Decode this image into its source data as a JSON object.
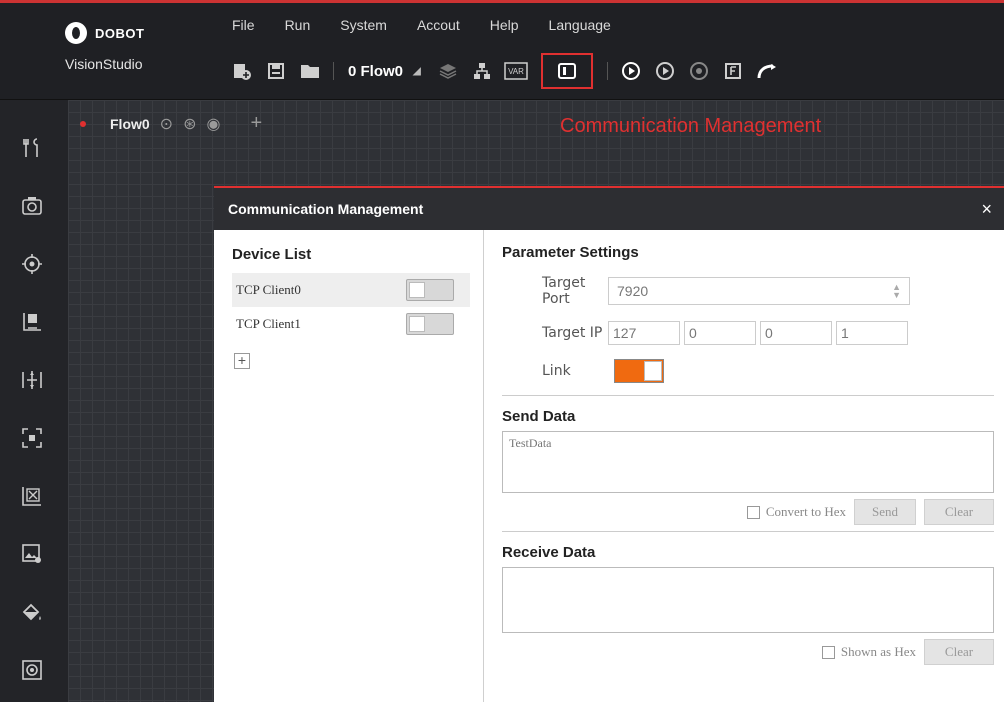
{
  "brand": {
    "name": "DOBOT",
    "product": "VisionStudio"
  },
  "menu": [
    "File",
    "Run",
    "System",
    "Accout",
    "Help",
    "Language"
  ],
  "toolbar": {
    "flow_selector": "0 Flow0",
    "var_label": "VAR"
  },
  "flow_tab": {
    "label": "Flow0"
  },
  "annotation": "Communication Management",
  "dialog": {
    "title": "Communication Management",
    "close": "×",
    "device_list": {
      "title": "Device List",
      "items": [
        {
          "label": "TCP Client0"
        },
        {
          "label": "TCP Client1"
        }
      ],
      "add": "+"
    },
    "params": {
      "title": "Parameter Settings",
      "target_port_label": "Target Port",
      "target_port_value": "7920",
      "target_ip_label": "Target IP",
      "ip": [
        "127",
        "0",
        "0",
        "1"
      ],
      "link_label": "Link"
    },
    "send": {
      "title": "Send Data",
      "value": "TestData",
      "convert_label": "Convert to Hex",
      "send_btn": "Send",
      "clear_btn": "Clear"
    },
    "receive": {
      "title": "Receive Data",
      "value": "",
      "shown_hex_label": "Shown as Hex",
      "clear_btn": "Clear"
    }
  },
  "colors": {
    "accent": "#e03030",
    "toggle_on": "#f06a10"
  }
}
